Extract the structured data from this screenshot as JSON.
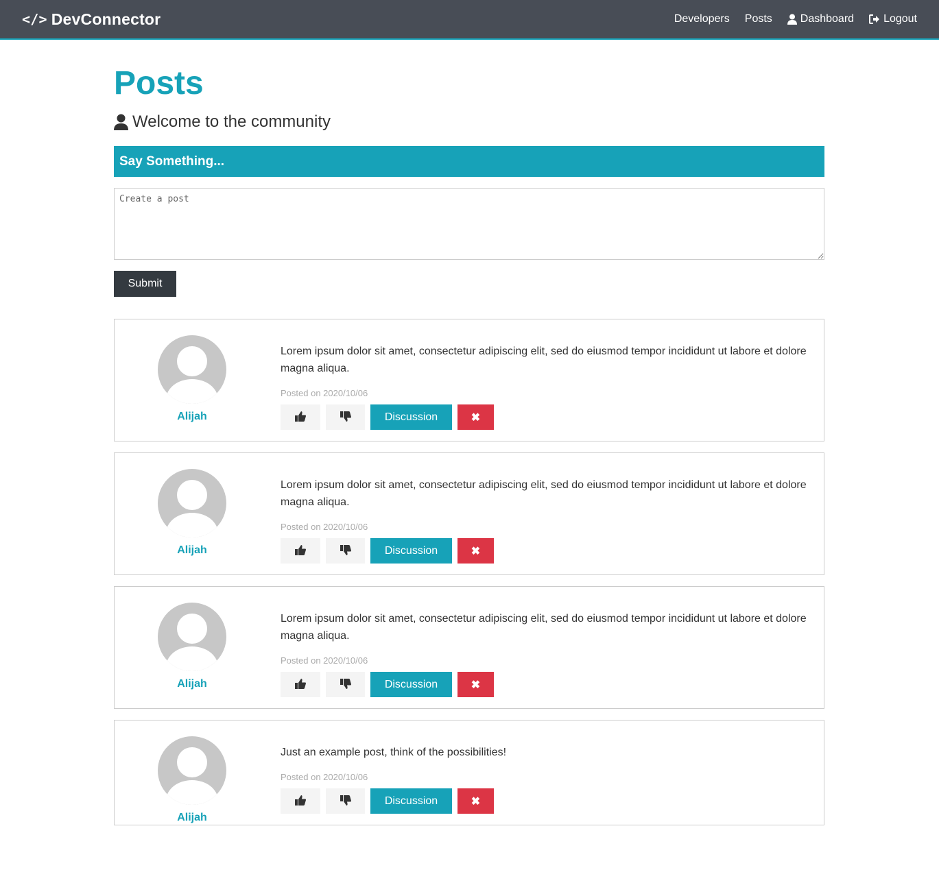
{
  "navbar": {
    "brand": "DevConnector",
    "brand_icon": "code-icon",
    "links": {
      "developers": "Developers",
      "posts": "Posts",
      "dashboard": "Dashboard",
      "logout": "Logout"
    }
  },
  "page": {
    "title": "Posts",
    "lead": "Welcome to the community"
  },
  "post_form": {
    "header": "Say Something...",
    "placeholder": "Create a post",
    "submit_label": "Submit"
  },
  "posts": [
    {
      "author": "Alijah",
      "text": "Lorem ipsum dolor sit amet, consectetur adipiscing elit, sed do eiusmod tempor incididunt ut labore et dolore magna aliqua.",
      "date": "Posted on 2020/10/06",
      "discussion_label": "Discussion",
      "delete_label": "✖"
    },
    {
      "author": "Alijah",
      "text": "Lorem ipsum dolor sit amet, consectetur adipiscing elit, sed do eiusmod tempor incididunt ut labore et dolore magna aliqua.",
      "date": "Posted on 2020/10/06",
      "discussion_label": "Discussion",
      "delete_label": "✖"
    },
    {
      "author": "Alijah",
      "text": "Lorem ipsum dolor sit amet, consectetur adipiscing elit, sed do eiusmod tempor incididunt ut labore et dolore magna aliqua.",
      "date": "Posted on 2020/10/06",
      "discussion_label": "Discussion",
      "delete_label": "✖"
    },
    {
      "author": "Alijah",
      "text": "Just an example post, think of the possibilities!",
      "date": "Posted on 2020/10/06",
      "discussion_label": "Discussion",
      "delete_label": "✖"
    }
  ],
  "colors": {
    "primary": "#17a2b8",
    "dark": "#343a40",
    "navbar": "#484d56",
    "danger": "#dc3545",
    "light": "#f4f4f4"
  }
}
